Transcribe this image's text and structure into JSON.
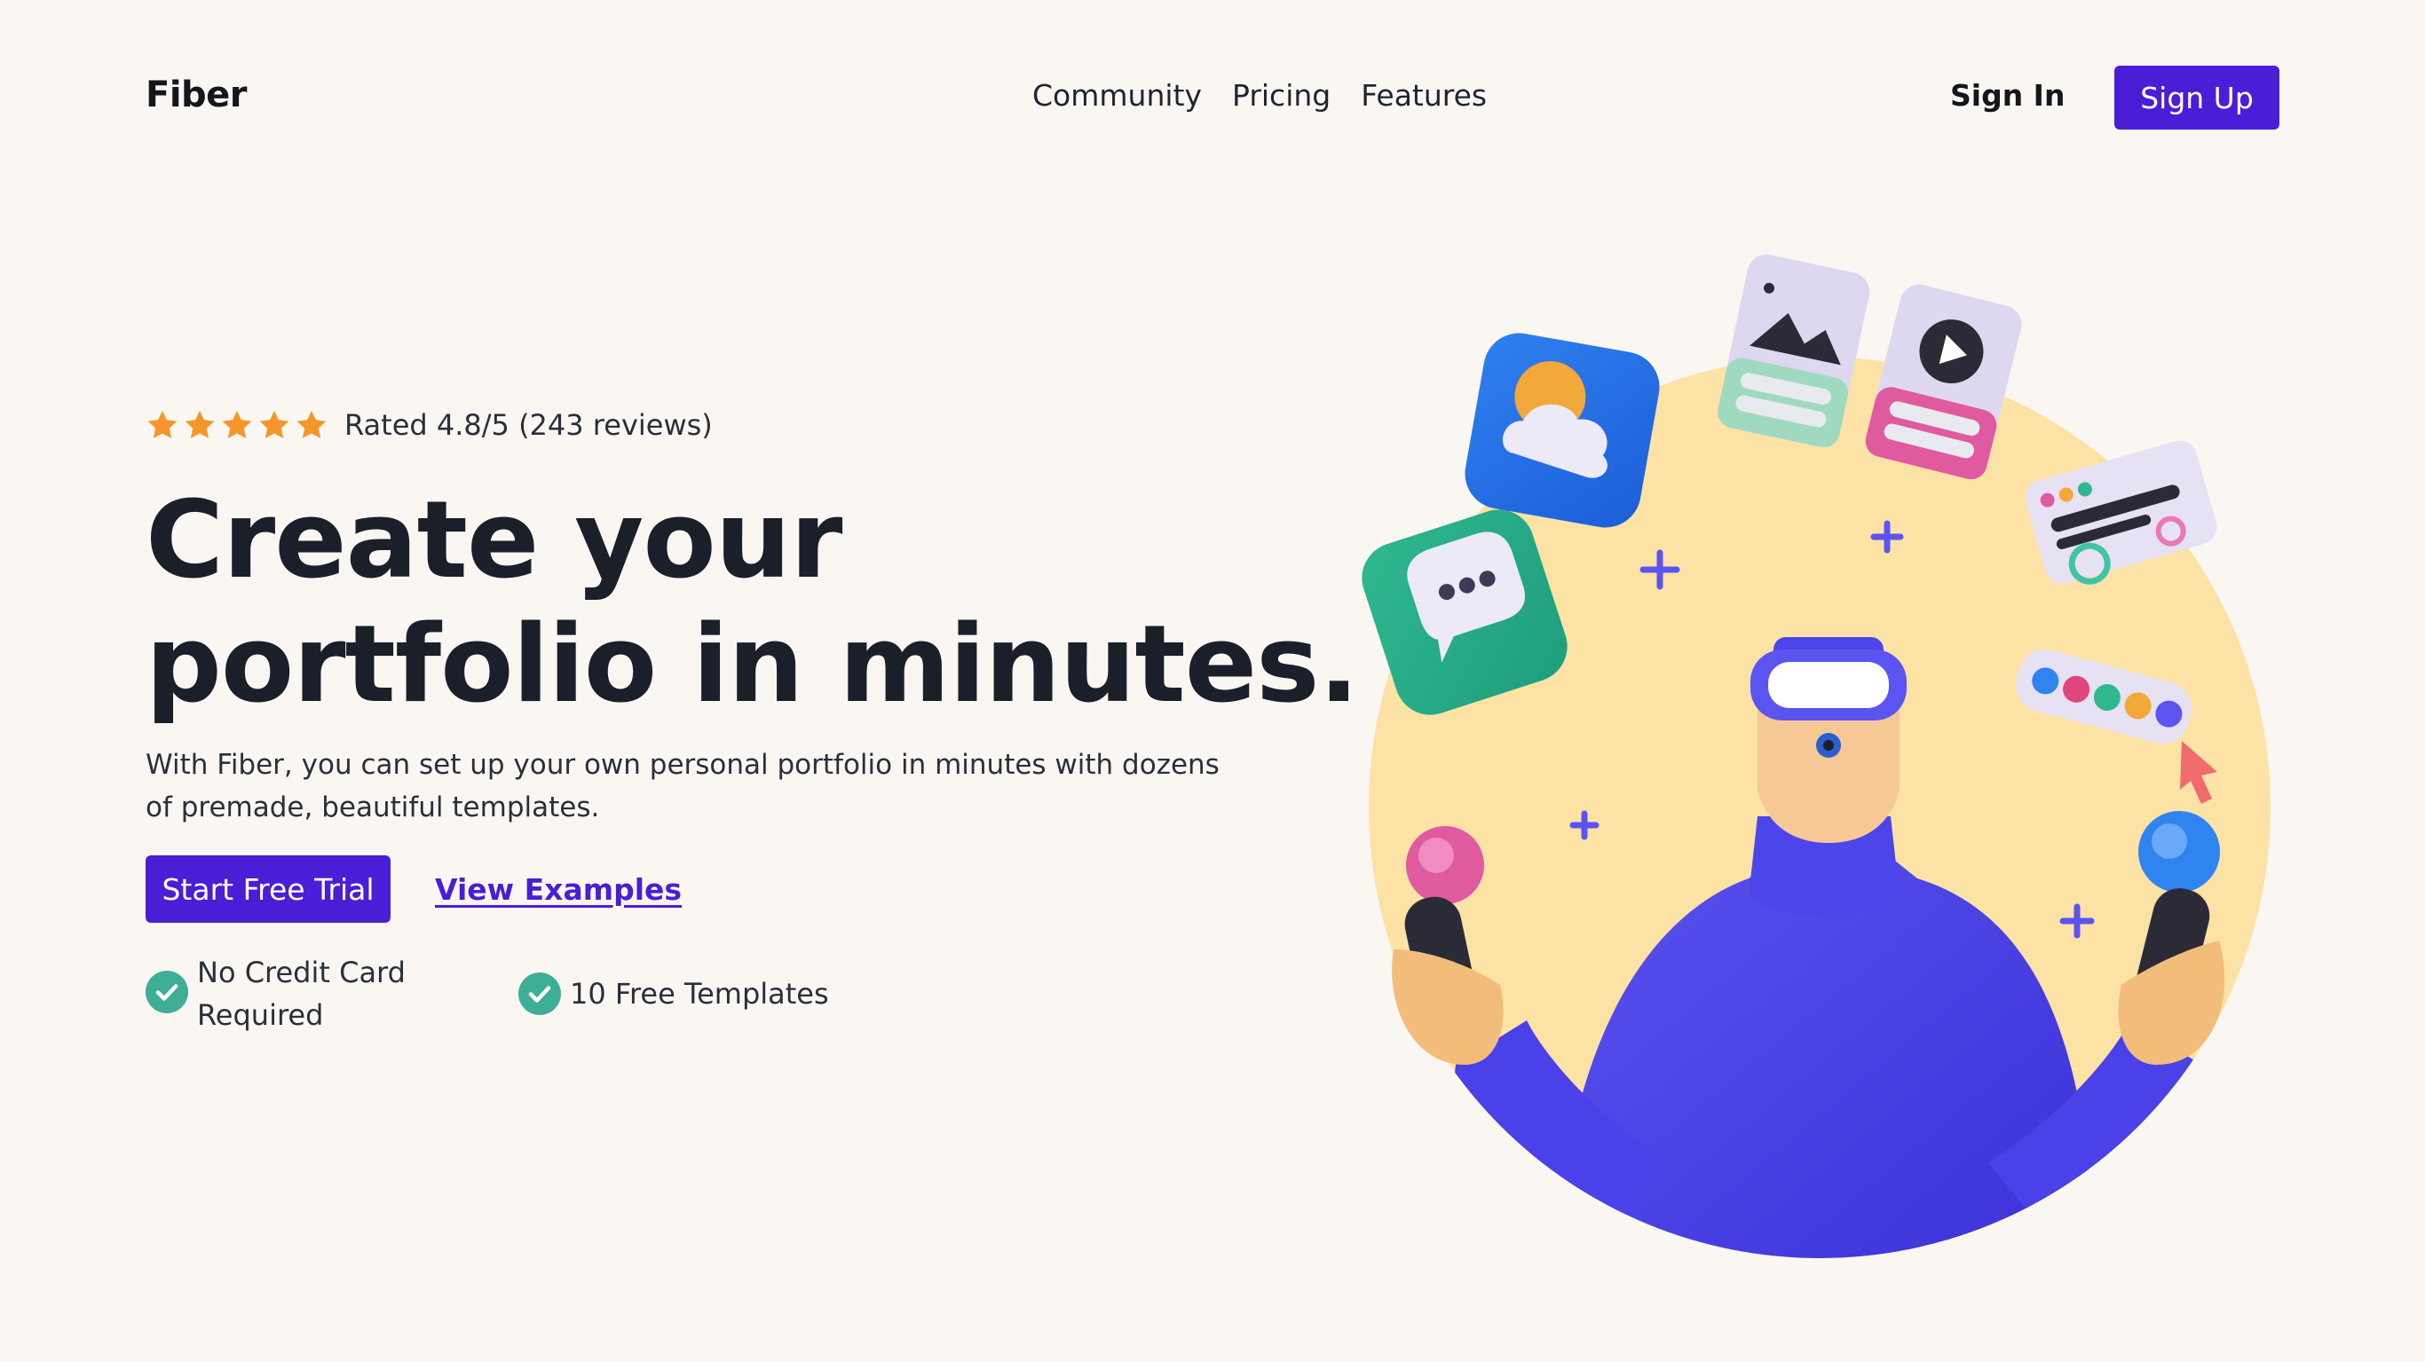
{
  "brand": "Fiber",
  "nav": {
    "links": [
      "Community",
      "Pricing",
      "Features"
    ],
    "sign_in": "Sign In",
    "sign_up": "Sign Up"
  },
  "hero": {
    "rating": {
      "stars": 5,
      "text": "Rated 4.8/5 (243 reviews)"
    },
    "headline_line1": "Create your",
    "headline_line2": "portfolio in minutes.",
    "subtext": "With Fiber, you can set up your own personal portfolio in minutes with dozens of premade, beautiful templates.",
    "cta_primary": "Start Free Trial",
    "cta_secondary": "View Examples",
    "features": [
      "No Credit Card Required",
      "10 Free Templates"
    ]
  },
  "colors": {
    "accent": "#4a1ed6",
    "star": "#f5962a",
    "check": "#3fae96",
    "background": "#faf7f2",
    "circle": "#fde2a6"
  },
  "icons": [
    "star-icon",
    "check-circle-icon"
  ]
}
